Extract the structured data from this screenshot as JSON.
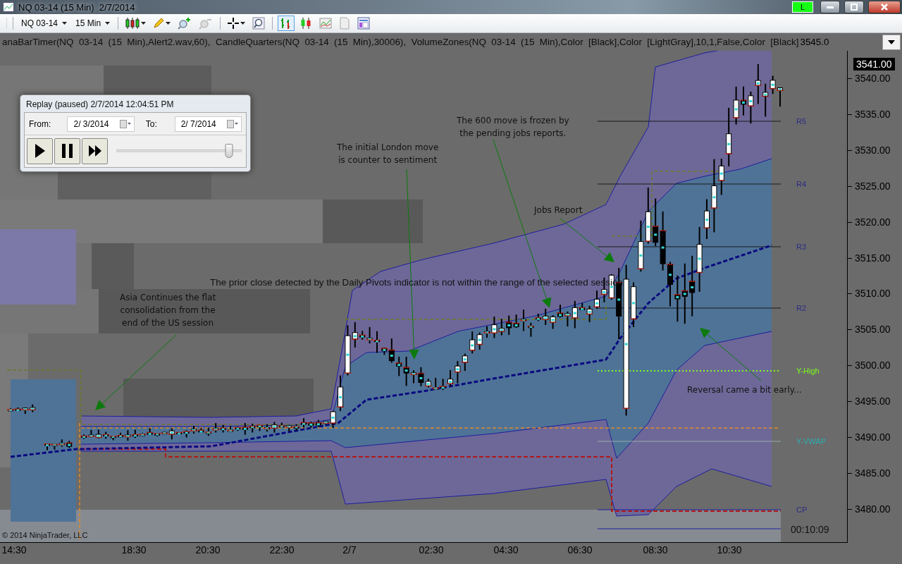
{
  "window": {
    "title": "NQ 03-14 (15 Min)  2/7/2014",
    "connection_badge": "L"
  },
  "toolbar": {
    "instrument": "NQ 03-14",
    "interval": "15 Min",
    "style_buttons": [
      {
        "kind": "bars",
        "selected": true
      },
      {
        "kind": "candles",
        "selected": false
      },
      {
        "kind": "line",
        "selected": false
      },
      {
        "kind": "data",
        "selected": false
      },
      {
        "kind": "properties",
        "selected": false
      }
    ]
  },
  "indicator_line": "anaBarTimer(NQ  03-14  (15  Min),Alert2.wav,60),  CandleQuarters(NQ  03-14  (15  Min),30006),  VolumeZones(NQ  03-14  (15  Min),Color  [Black],Color  [LightGray],10,1,False,Color  [Black]",
  "chart": {
    "pivot_labels": [
      {
        "label": "R5",
        "color": "#2c2c84"
      },
      {
        "label": "R4",
        "color": "#2c2c84"
      },
      {
        "label": "R3",
        "color": "#2c2c84"
      },
      {
        "label": "R2",
        "color": "#2c2c84"
      },
      {
        "label": "Y-High",
        "color": "#7cff1c"
      },
      {
        "label": "Y-VWAP",
        "color": "#2aaeb0"
      },
      {
        "label": "CP",
        "color": "#2c2c84"
      }
    ],
    "annotations": [
      {
        "kind": "note",
        "text": "The 600 move is frozen by\nthe pending jobs reports."
      },
      {
        "kind": "note",
        "text": "The initial London move\nis counter to sentiment"
      },
      {
        "kind": "note",
        "text": "Jobs Report"
      },
      {
        "kind": "message",
        "text": "The prior close detected by the Daily Pivots indicator is not within the range of the selected session"
      },
      {
        "kind": "note",
        "text": "Asia Continues the flat\nconsolidation from the\nend of the US session"
      },
      {
        "kind": "note",
        "text": "Reversal came a bit early..."
      }
    ],
    "last_price": "3541.00",
    "bar_timer": "00:10:09",
    "copyright": "© 2014 NinjaTrader, LLC"
  },
  "price_axis": [
    "3545.0",
    "3540.00",
    "3535.00",
    "3530.00",
    "3525.00",
    "3520.00",
    "3515.00",
    "3510.00",
    "3505.00",
    "3500.00",
    "3495.00",
    "3490.00",
    "3485.00",
    "3480.00"
  ],
  "time_axis": [
    "14:30",
    "18:30",
    "20:30",
    "22:30",
    "2/7",
    "02:30",
    "04:30",
    "06:30",
    "08:30",
    "10:30"
  ],
  "replay": {
    "title": "Replay (paused) 2/7/2014 12:04:51 PM",
    "from_label": "From:",
    "from_date": "2/ 3/2014",
    "to_label": "To:",
    "to_date": "2/ 7/2014",
    "speed": {
      "level": 0.93
    }
  }
}
